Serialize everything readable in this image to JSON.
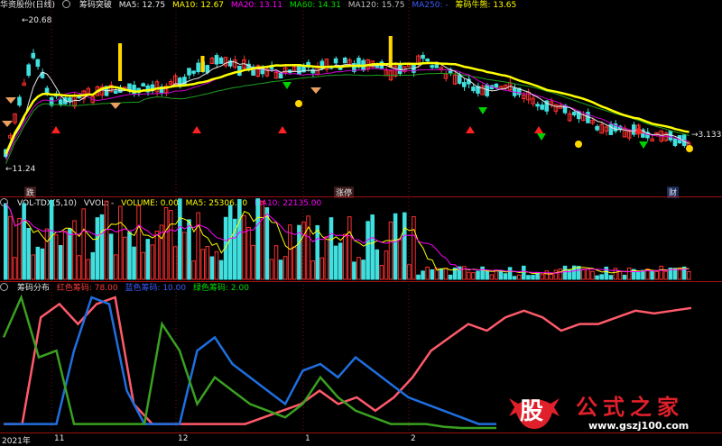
{
  "panel_price": {
    "title": "华资股份(日线)",
    "indicator": "筹码突破",
    "ma": [
      {
        "label": "MA5: 12.75",
        "color": "#e8e8e8"
      },
      {
        "label": "MA10: 12.67",
        "color": "#ffff00"
      },
      {
        "label": "MA20: 13.11",
        "color": "#ff00ff"
      },
      {
        "label": "MA60: 14.31",
        "color": "#00e000"
      },
      {
        "label": "MA120: 15.75",
        "color": "#c0c0c0"
      },
      {
        "label": "MA250: -",
        "color": "#3a5bff"
      },
      {
        "label": "筹码牛熊: 13.65",
        "color": "#ffff00"
      }
    ],
    "high_label": "20.68",
    "low_label": "11.24",
    "last_label": "3.133",
    "event_markers": [
      "跌",
      "涨停",
      "财"
    ]
  },
  "panel_volume": {
    "title": "VOL-TDX(5,10)",
    "vvol": "VVOL: -",
    "volume": "VOLUME: 0.00",
    "ma5": "MA5: 25306.10",
    "ma10": "MA10: 22135.00"
  },
  "panel_chips": {
    "title": "筹码分布",
    "red": "红色筹码: 78.00",
    "blue": "蓝色筹码: 10.00",
    "green": "绿色筹码: 2.00"
  },
  "x_axis": {
    "labels": [
      "2021年",
      "11",
      "12",
      "1",
      "2"
    ]
  },
  "watermark": {
    "char": "股",
    "text": "公式之家",
    "url": "www.gszj100.com"
  },
  "chart_data": {
    "type": "line",
    "series": [
      {
        "name": "红色筹码",
        "values": [
          5,
          5,
          85,
          95,
          80,
          95,
          100,
          20,
          5,
          5,
          5,
          5,
          5,
          5,
          10,
          15,
          20,
          30,
          20,
          25,
          15,
          25,
          40,
          60,
          70,
          80,
          75,
          85,
          90,
          85,
          75,
          80,
          80,
          85,
          90,
          88,
          90,
          92
        ]
      },
      {
        "name": "蓝色筹码",
        "values": [
          5,
          5,
          5,
          5,
          60,
          100,
          95,
          30,
          5,
          5,
          5,
          60,
          70,
          50,
          40,
          30,
          20,
          45,
          50,
          40,
          55,
          45,
          35,
          25,
          20,
          15,
          10,
          5,
          5
        ]
      },
      {
        "name": "绿色筹码",
        "values": [
          70,
          100,
          55,
          60,
          5,
          5,
          5,
          5,
          5,
          80,
          60,
          20,
          40,
          30,
          20,
          15,
          10,
          20,
          40,
          25,
          15,
          10,
          5,
          5,
          5,
          3,
          2,
          2,
          2
        ]
      }
    ]
  }
}
